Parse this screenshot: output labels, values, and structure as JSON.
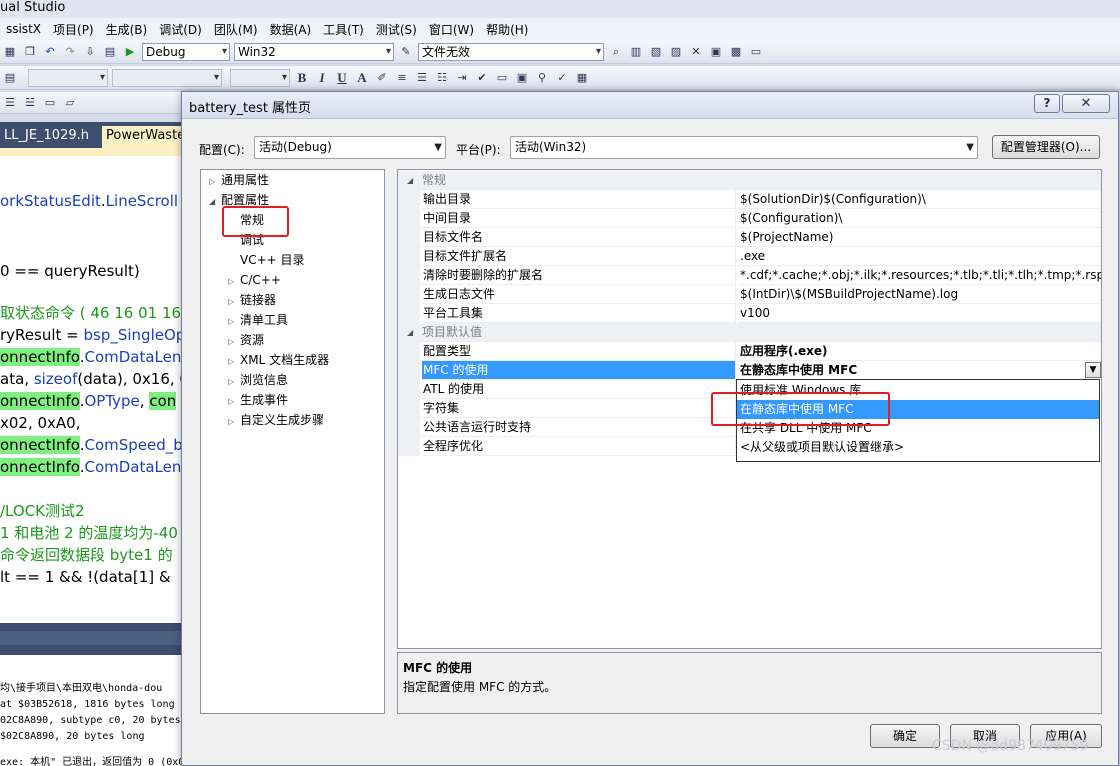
{
  "ide": {
    "title": "ual Studio",
    "menu": [
      "ssistX",
      "项目(P)",
      "生成(B)",
      "调试(D)",
      "团队(M)",
      "数据(A)",
      "工具(T)",
      "测试(S)",
      "窗口(W)",
      "帮助(H)"
    ],
    "toolbar": {
      "config": "Debug",
      "platform": "Win32",
      "find": "文件无效"
    },
    "tabs": [
      "LL_JE_1029.h",
      "PowerWaste"
    ],
    "code": [
      {
        "segments": [
          {
            "t": "orkStatusEdit",
            "c": "id"
          },
          {
            "t": ".",
            "c": ""
          },
          {
            "t": "LineScroll",
            "c": "id"
          }
        ]
      },
      {
        "segments": [
          {
            "t": "0 == queryResult)",
            "c": ""
          }
        ]
      },
      {
        "segments": [
          {
            "t": "取状态命令 ( 46 16 01 16",
            "c": "cmt"
          }
        ]
      },
      {
        "segments": [
          {
            "t": "ryResult = ",
            "c": ""
          },
          {
            "t": "bsp_SingleOp",
            "c": "id"
          }
        ]
      },
      {
        "segments": [
          {
            "t": "onnectInfo",
            "c": "hl"
          },
          {
            "t": ".",
            "c": ""
          },
          {
            "t": "ComDataLen",
            "c": "id"
          }
        ]
      },
      {
        "segments": [
          {
            "t": "ata, ",
            "c": ""
          },
          {
            "t": "sizeof",
            "c": "kw"
          },
          {
            "t": "(data), 0x16, 0",
            "c": ""
          }
        ]
      },
      {
        "segments": [
          {
            "t": "onnectInfo",
            "c": "hl"
          },
          {
            "t": ".",
            "c": ""
          },
          {
            "t": "OPType",
            "c": "id"
          },
          {
            "t": ", ",
            "c": ""
          },
          {
            "t": "con",
            "c": "hl"
          }
        ]
      },
      {
        "segments": [
          {
            "t": "x02, 0xA0,",
            "c": ""
          }
        ]
      },
      {
        "segments": [
          {
            "t": "onnectInfo",
            "c": "hl"
          },
          {
            "t": ".",
            "c": ""
          },
          {
            "t": "ComSpeed_b",
            "c": "id"
          }
        ]
      },
      {
        "segments": [
          {
            "t": "onnectInfo",
            "c": "hl"
          },
          {
            "t": ".",
            "c": ""
          },
          {
            "t": "ComDataLen",
            "c": "id"
          }
        ]
      },
      {
        "segments": [
          {
            "t": "/LOCK测试2",
            "c": "cmt"
          }
        ]
      },
      {
        "segments": [
          {
            "t": "1 和电池 2 的温度均为-40",
            "c": "cmt"
          }
        ]
      },
      {
        "segments": [
          {
            "t": "命令返回数据段 byte1 的",
            "c": "cmt"
          }
        ]
      },
      {
        "segments": [
          {
            "t": "lt == 1 && !(data[1] &",
            "c": ""
          }
        ]
      }
    ],
    "output": [
      "均\\接手项目\\本田双电\\honda-dou",
      " at $03B52618, 1816 bytes long",
      "02C8A890, subtype c0, 20 bytes",
      " $02C8A890, 20 bytes long",
      "exe: 本机\" 已退出，返回值为 0 (0x0)"
    ]
  },
  "dialog": {
    "title": "battery_test 属性页",
    "help_label": "?",
    "close_label": "✕",
    "config_label": "配置(C):",
    "config_value": "活动(Debug)",
    "platform_label": "平台(P):",
    "platform_value": "活动(Win32)",
    "config_manager_label": "配置管理器(O)...",
    "tree": [
      {
        "label": "通用属性",
        "arrow": "▷",
        "indent": 0
      },
      {
        "label": "配置属性",
        "arrow": "◢",
        "indent": 0
      },
      {
        "label": "常规",
        "arrow": "",
        "indent": 1
      },
      {
        "label": "调试",
        "arrow": "",
        "indent": 1
      },
      {
        "label": "VC++ 目录",
        "arrow": "",
        "indent": 1
      },
      {
        "label": "C/C++",
        "arrow": "▷",
        "indent": 1
      },
      {
        "label": "链接器",
        "arrow": "▷",
        "indent": 1
      },
      {
        "label": "清单工具",
        "arrow": "▷",
        "indent": 1
      },
      {
        "label": "资源",
        "arrow": "▷",
        "indent": 1
      },
      {
        "label": "XML 文档生成器",
        "arrow": "▷",
        "indent": 1
      },
      {
        "label": "浏览信息",
        "arrow": "▷",
        "indent": 1
      },
      {
        "label": "生成事件",
        "arrow": "▷",
        "indent": 1
      },
      {
        "label": "自定义生成步骤",
        "arrow": "▷",
        "indent": 1
      }
    ],
    "grid": {
      "cat_general": "常规",
      "general": [
        {
          "name": "输出目录",
          "value": "$(SolutionDir)$(Configuration)\\"
        },
        {
          "name": "中间目录",
          "value": "$(Configuration)\\"
        },
        {
          "name": "目标文件名",
          "value": "$(ProjectName)"
        },
        {
          "name": "目标文件扩展名",
          "value": ".exe"
        },
        {
          "name": "清除时要删除的扩展名",
          "value": "*.cdf;*.cache;*.obj;*.ilk;*.resources;*.tlb;*.tli;*.tlh;*.tmp;*.rsp;*.pgc"
        },
        {
          "name": "生成日志文件",
          "value": "$(IntDir)\\$(MSBuildProjectName).log"
        },
        {
          "name": "平台工具集",
          "value": "v100"
        }
      ],
      "cat_defaults": "项目默认值",
      "defaults": [
        {
          "name": "配置类型",
          "value": "应用程序(.exe)"
        },
        {
          "name": "MFC 的使用",
          "value": "在静态库中使用 MFC"
        },
        {
          "name": "ATL 的使用",
          "value": ""
        },
        {
          "name": "字符集",
          "value": ""
        },
        {
          "name": "公共语言运行时支持",
          "value": ""
        },
        {
          "name": "全程序优化",
          "value": ""
        }
      ]
    },
    "dropdown": [
      "使用标准 Windows 库",
      "在静态库中使用 MFC",
      "在共享 DLL 中使用 MFC",
      "<从父级或项目默认设置继承>"
    ],
    "description": {
      "title": "MFC 的使用",
      "text": "指定配置使用 MFC 的方式。"
    },
    "ok_label": "确定",
    "cancel_label": "取消",
    "apply_label": "应用(A)"
  },
  "watermark": "CSDN @dd987409759"
}
